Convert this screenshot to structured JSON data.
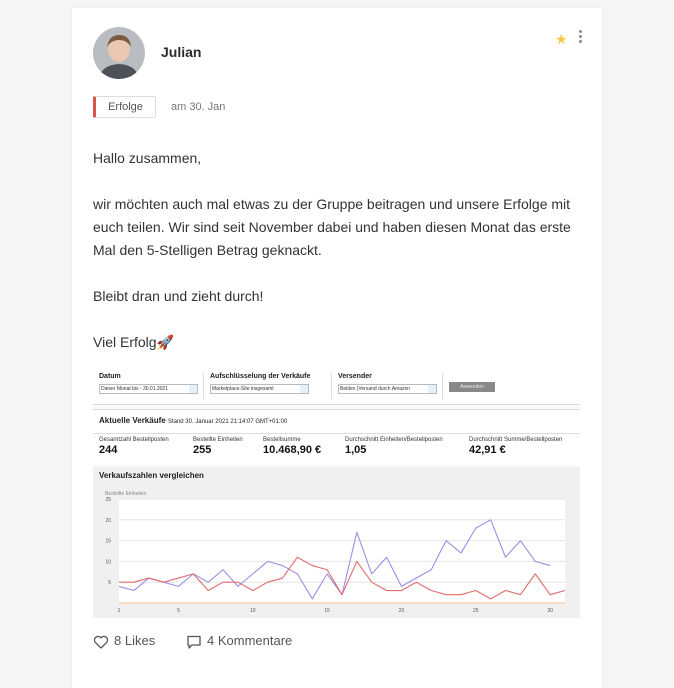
{
  "post": {
    "author": "Julian",
    "tag": "Erfolge",
    "date": "am 30. Jan",
    "greeting": "Hallo zusammen,",
    "paragraph": "wir möchten auch mal etwas zu der Gruppe beitragen und unsere Erfolge mit euch teilen. Wir sind seit November dabei und haben diesen Monat das erste Mal den 5-Stelligen Betrag geknackt.",
    "encouragement": "Bleibt dran und zieht durch!",
    "closing": "Viel Erfolg🚀",
    "starred": true,
    "star_color": "#f2c94c",
    "tag_accent": "#d9534f"
  },
  "screenshot": {
    "filters": {
      "date_label": "Datum",
      "date_value": "Dieser Monat bis - 30.01.2021",
      "breakdown_label": "Aufschlüsselung der Verkäufe",
      "breakdown_value": "Marketplace-Site insgesamt",
      "shipper_label": "Versender",
      "shipper_value": "Beides (Versand durch Amazon",
      "apply_label": "Anwenden"
    },
    "sales": {
      "title": "Aktuelle Verkäufe",
      "stand": "Stand 30. Januar 2021 21:14:07 GMT+01:00",
      "metrics": [
        {
          "label": "Gesamtzahl Bestellposten",
          "value": "244"
        },
        {
          "label": "Bestellte Einheiten",
          "value": "255"
        },
        {
          "label": "Bestellsumme",
          "value": "10.468,90 €"
        },
        {
          "label": "Durchschnitt Einheiten/Bestellposten",
          "value": "1,05"
        },
        {
          "label": "Durchschnitt Summe/Bestellposten",
          "value": "42,91 €"
        }
      ]
    }
  },
  "chart_data": {
    "type": "line",
    "title": "Verkaufszahlen vergleichen",
    "ylabel": "Bestellte Einheiten",
    "ylim": [
      0,
      25
    ],
    "yticks": [
      "25",
      "20",
      "15",
      "10",
      "5"
    ],
    "xticks": [
      "1",
      "5",
      "10",
      "15",
      "20",
      "25",
      "30"
    ],
    "xlim": [
      1,
      31
    ],
    "grid": true,
    "series": [
      {
        "color": "#9b8fe6",
        "values": [
          4,
          3,
          6,
          5,
          4,
          7,
          5,
          8,
          4,
          7,
          10,
          9,
          7,
          1,
          7,
          2,
          17,
          7,
          11,
          4,
          6,
          8,
          15,
          12,
          18,
          20,
          11,
          15,
          10,
          9
        ]
      },
      {
        "color": "#e06c6c",
        "values": [
          5,
          5,
          6,
          5,
          6,
          7,
          3,
          5,
          5,
          3,
          5,
          6,
          11,
          9,
          8,
          2,
          10,
          5,
          3,
          3,
          5,
          3,
          2,
          2,
          3,
          1,
          3,
          2,
          7,
          2,
          3
        ]
      },
      {
        "color": "#f5c48a",
        "values": [
          0,
          0,
          0,
          0,
          0,
          0,
          0,
          0,
          0,
          0,
          0,
          0,
          0,
          0,
          0,
          0,
          0,
          0,
          0,
          0,
          0,
          0,
          0,
          0,
          0,
          0,
          0,
          0,
          0,
          0,
          0
        ]
      }
    ]
  },
  "actions": {
    "likes": "8 Likes",
    "comments": "4 Kommentare"
  },
  "icons": {
    "more": "more-vertical-icon",
    "star": "star-icon",
    "like": "heart-icon",
    "comment": "comment-icon"
  }
}
